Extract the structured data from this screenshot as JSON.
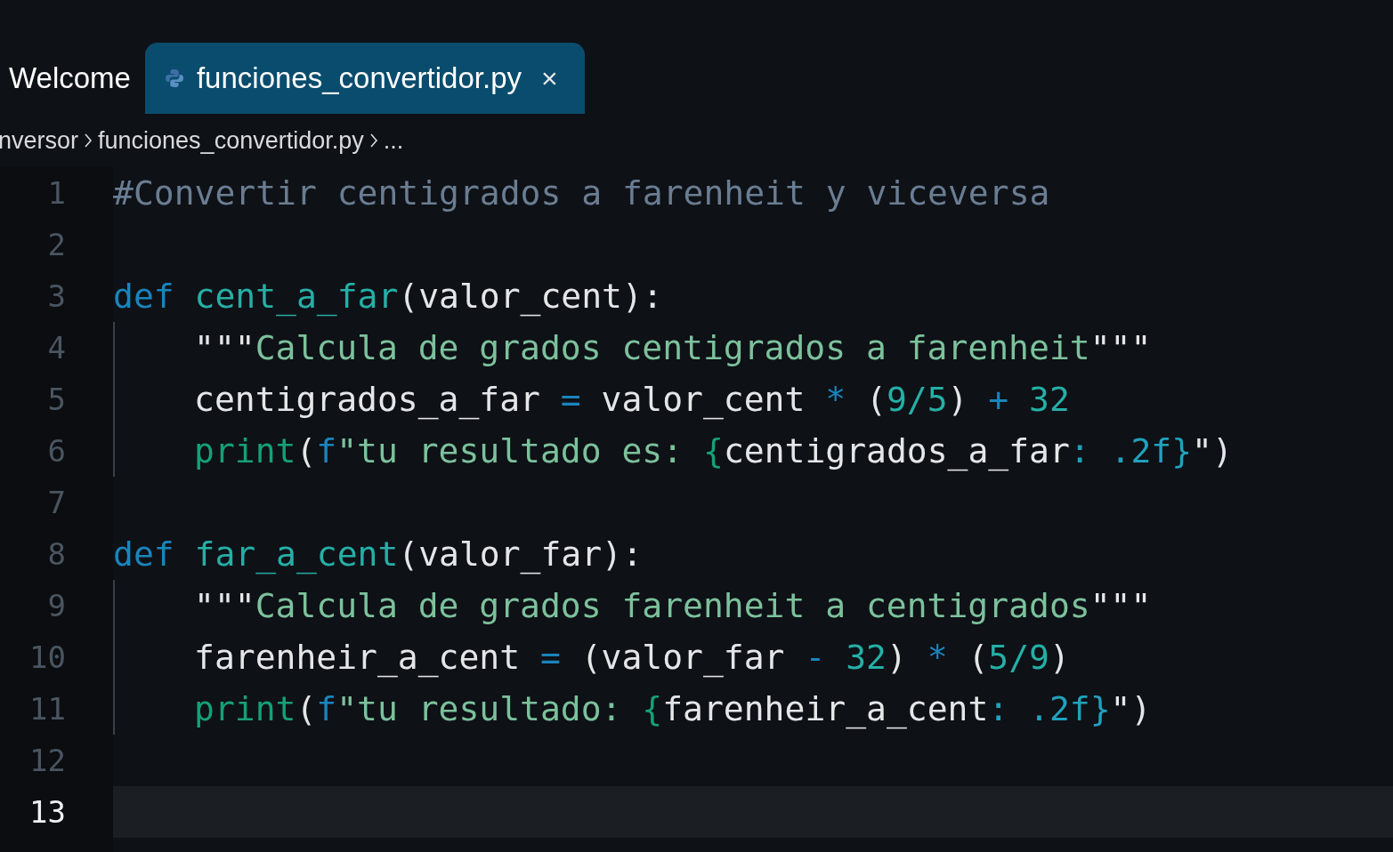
{
  "tabs": [
    {
      "label": "Welcome",
      "selected": false
    },
    {
      "label": "funciones_convertidor.py",
      "selected": true,
      "close": "×"
    }
  ],
  "breadcrumb": [
    "nversor",
    "funciones_convertidor.py",
    "..."
  ],
  "lines": [
    {
      "number": "1",
      "current": false,
      "guide": false,
      "tokens": [
        {
          "kind": "comment",
          "text": "#Convertir centigrados a farenheit y viceversa"
        }
      ]
    },
    {
      "number": "2",
      "current": false,
      "guide": false
    },
    {
      "number": "3",
      "current": false,
      "guide": false,
      "tokens": [
        {
          "kind": "keyword",
          "text": "def"
        },
        {
          "kind": "function",
          "text": " cent_a_far"
        },
        {
          "kind": "plain",
          "text": "(valor_cent):"
        }
      ]
    },
    {
      "number": "4",
      "current": false,
      "guide": true,
      "tokens": [
        {
          "kind": "plain",
          "text": "\"\"\""
        },
        {
          "kind": "string",
          "text": "Calcula de grados centigrados a farenheit"
        },
        {
          "kind": "plain",
          "text": "\"\"\""
        }
      ]
    },
    {
      "number": "5",
      "current": false,
      "guide": true,
      "tokens": [
        {
          "kind": "plain",
          "text": "centigrados_a_far "
        },
        {
          "kind": "operator",
          "text": "="
        },
        {
          "kind": "plain",
          "text": " valor_cent "
        },
        {
          "kind": "operator",
          "text": "*"
        },
        {
          "kind": "plain",
          "text": " ("
        },
        {
          "kind": "number",
          "text": "9/5"
        },
        {
          "kind": "plain",
          "text": ") "
        },
        {
          "kind": "operator",
          "text": "+"
        },
        {
          "kind": "number",
          "text": " 32"
        }
      ]
    },
    {
      "number": "6",
      "current": false,
      "guide": true,
      "tokens": [
        {
          "kind": "builtin",
          "text": "print"
        },
        {
          "kind": "plain",
          "text": "("
        },
        {
          "kind": "keyword",
          "text": "f"
        },
        {
          "kind": "string",
          "text": "\"tu resultado es: "
        },
        {
          "kind": "builtin",
          "text": "{"
        },
        {
          "kind": "plain",
          "text": "centigrados_a_far"
        },
        {
          "kind": "format",
          "text": ": .2f}"
        },
        {
          "kind": "plain",
          "text": "\")"
        }
      ]
    },
    {
      "number": "7",
      "current": false,
      "guide": false
    },
    {
      "number": "8",
      "current": false,
      "guide": false,
      "tokens": [
        {
          "kind": "keyword",
          "text": "def"
        },
        {
          "kind": "function",
          "text": " far_a_cent"
        },
        {
          "kind": "plain",
          "text": "(valor_far):"
        }
      ]
    },
    {
      "number": "9",
      "current": false,
      "guide": true,
      "tokens": [
        {
          "kind": "plain",
          "text": "\"\"\""
        },
        {
          "kind": "string",
          "text": "Calcula de grados farenheit a centigrados"
        },
        {
          "kind": "plain",
          "text": "\"\"\""
        }
      ]
    },
    {
      "number": "10",
      "current": false,
      "guide": true,
      "tokens": [
        {
          "kind": "plain",
          "text": "farenheir_a_cent "
        },
        {
          "kind": "operator",
          "text": "="
        },
        {
          "kind": "plain",
          "text": " (valor_far "
        },
        {
          "kind": "operator",
          "text": "-"
        },
        {
          "kind": "number",
          "text": " 32"
        },
        {
          "kind": "plain",
          "text": ") "
        },
        {
          "kind": "operator",
          "text": "*"
        },
        {
          "kind": "plain",
          "text": " ("
        },
        {
          "kind": "number",
          "text": "5/9"
        },
        {
          "kind": "plain",
          "text": ")"
        }
      ]
    },
    {
      "number": "11",
      "current": false,
      "guide": true,
      "tokens": [
        {
          "kind": "builtin",
          "text": "print"
        },
        {
          "kind": "plain",
          "text": "("
        },
        {
          "kind": "keyword",
          "text": "f"
        },
        {
          "kind": "string",
          "text": "\"tu resultado: "
        },
        {
          "kind": "builtin",
          "text": "{"
        },
        {
          "kind": "plain",
          "text": "farenheir_a_cent"
        },
        {
          "kind": "format",
          "text": ": .2f}"
        },
        {
          "kind": "plain",
          "text": "\")"
        }
      ]
    },
    {
      "number": "12",
      "current": false,
      "guide": false
    },
    {
      "number": "13",
      "current": true,
      "guide": false
    }
  ]
}
